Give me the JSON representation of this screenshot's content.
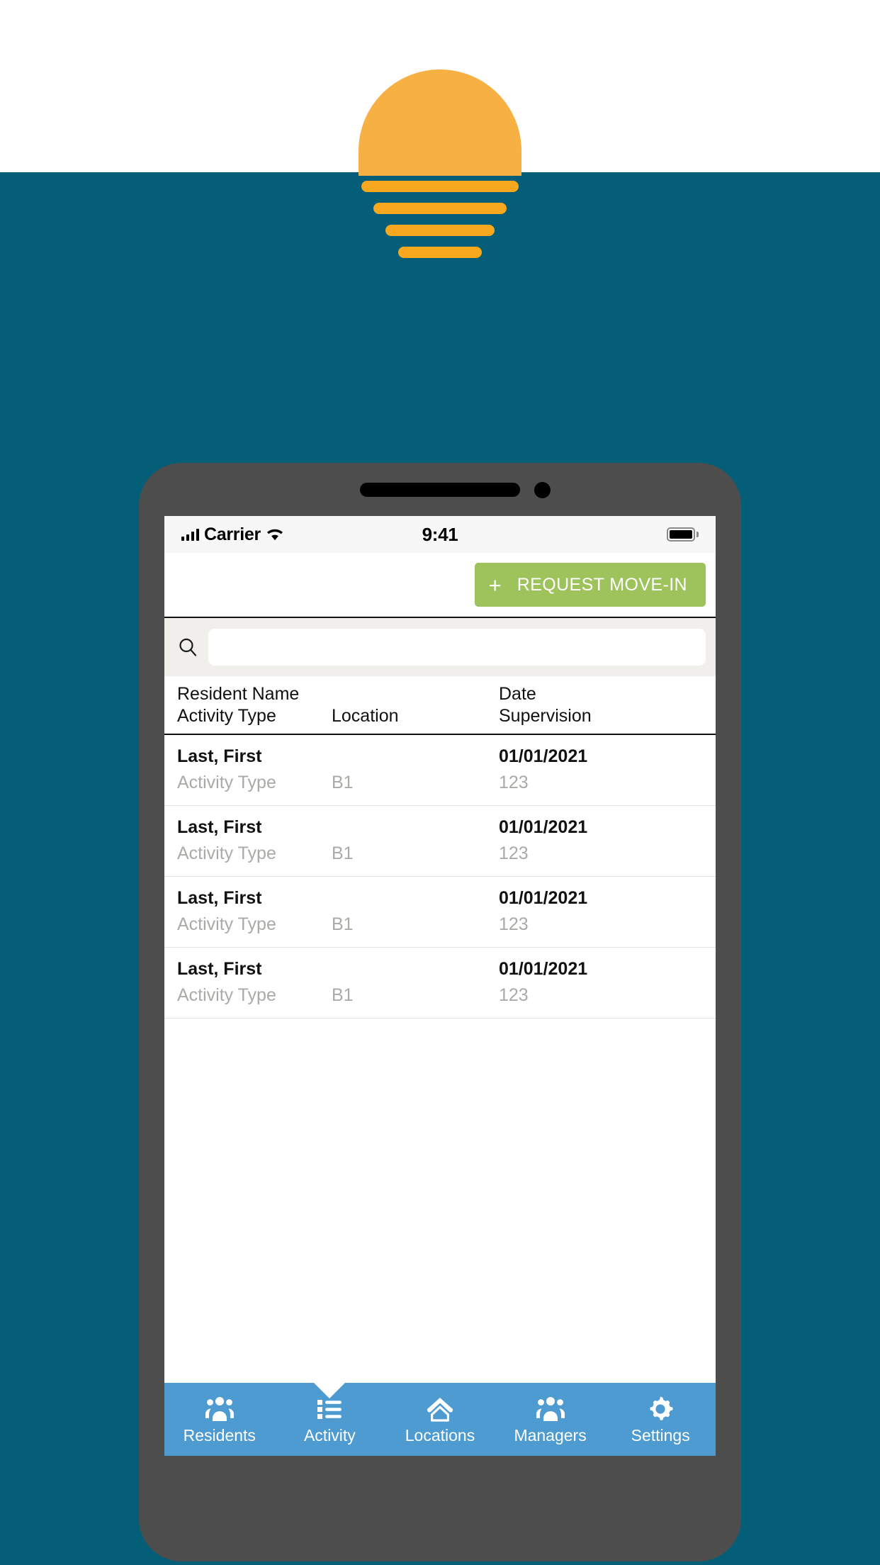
{
  "background": {
    "white_band_color": "#ffffff",
    "teal_color": "#045e78"
  },
  "logo": {
    "name": "sunset-logo",
    "sun_color": "#f7b043",
    "ray_color": "#f7a81e",
    "ray_count": 4
  },
  "phone": {
    "frame_color": "#4d4d4d",
    "screen_color": "#ffffff"
  },
  "status_bar": {
    "carrier": "Carrier",
    "time": "9:41",
    "signal_icon": "signal-bars-icon",
    "wifi_icon": "wifi-icon",
    "battery_icon": "battery-full-icon"
  },
  "action_bar": {
    "request_move_in_label": "REQUEST MOVE-IN",
    "plus_glyph": "+",
    "button_color": "#9ec35c"
  },
  "search": {
    "icon": "search-icon",
    "value": "",
    "placeholder": ""
  },
  "table": {
    "headers": {
      "line1": {
        "col_a": "Resident Name",
        "col_b": "",
        "col_c": "Date"
      },
      "line2": {
        "col_a": "Activity Type",
        "col_b": "Location",
        "col_c": "Supervision"
      }
    },
    "rows": [
      {
        "name": "Last, First",
        "date": "01/01/2021",
        "activity_type": "Activity Type",
        "location": "B1",
        "supervision": "123"
      },
      {
        "name": "Last, First",
        "date": "01/01/2021",
        "activity_type": "Activity Type",
        "location": "B1",
        "supervision": "123"
      },
      {
        "name": "Last, First",
        "date": "01/01/2021",
        "activity_type": "Activity Type",
        "location": "B1",
        "supervision": "123"
      },
      {
        "name": "Last, First",
        "date": "01/01/2021",
        "activity_type": "Activity Type",
        "location": "B1",
        "supervision": "123"
      }
    ]
  },
  "bottom_nav": {
    "background_color": "#4d9bd1",
    "active_index": 1,
    "items": [
      {
        "label": "Residents",
        "icon": "people-group-icon"
      },
      {
        "label": "Activity",
        "icon": "list-bullets-icon"
      },
      {
        "label": "Locations",
        "icon": "home-icon"
      },
      {
        "label": "Managers",
        "icon": "people-group-icon"
      },
      {
        "label": "Settings",
        "icon": "gear-icon"
      }
    ]
  }
}
